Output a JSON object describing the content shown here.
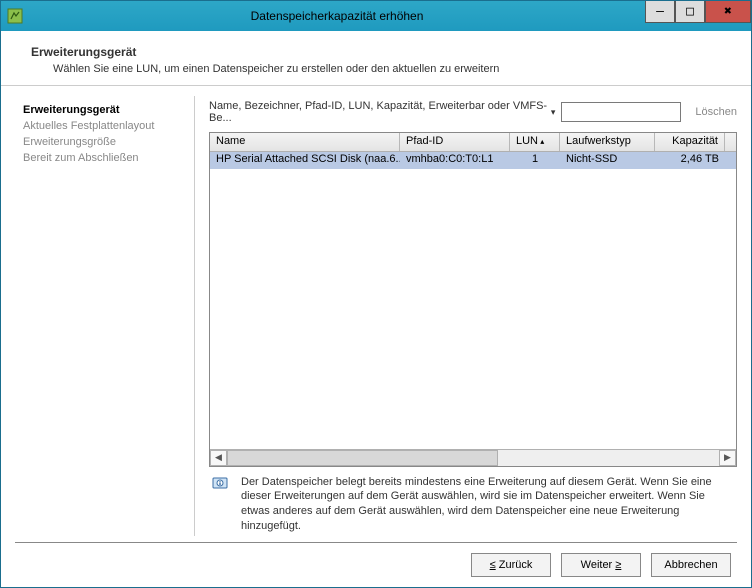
{
  "window": {
    "title": "Datenspeicherkapazität erhöhen"
  },
  "header": {
    "title": "Erweiterungsgerät",
    "subtitle": "Wählen Sie eine LUN, um einen Datenspeicher zu erstellen oder den aktuellen zu erweitern"
  },
  "sidebar": {
    "steps": [
      {
        "label": "Erweiterungsgerät",
        "active": true
      },
      {
        "label": "Aktuelles Festplattenlayout",
        "active": false
      },
      {
        "label": "Erweiterungsgröße",
        "active": false
      },
      {
        "label": "Bereit zum Abschließen",
        "active": false
      }
    ]
  },
  "filter": {
    "label": "Name, Bezeichner, Pfad-ID, LUN, Kapazität, Erweiterbar oder VMFS-Be...",
    "value": "",
    "clear_label": "Löschen"
  },
  "table": {
    "columns": {
      "name": "Name",
      "path": "Pfad-ID",
      "lun": "LUN",
      "type": "Laufwerkstyp",
      "capacity": "Kapazität"
    },
    "rows": [
      {
        "name": "HP Serial Attached SCSI Disk (naa.6...",
        "path": "vmhba0:C0:T0:L1",
        "lun": "1",
        "type": "Nicht-SSD",
        "capacity": "2,46 TB",
        "selected": true
      }
    ]
  },
  "info": {
    "text": "Der Datenspeicher belegt bereits mindestens eine Erweiterung auf diesem Gerät. Wenn Sie eine dieser Erweiterungen auf dem Gerät auswählen, wird sie im Datenspeicher erweitert. Wenn Sie etwas anderes auf dem Gerät auswählen, wird dem Datenspeicher eine neue Erweiterung hinzugefügt."
  },
  "footer": {
    "back": "Zurück",
    "next": "Weiter",
    "cancel": "Abbrechen"
  }
}
